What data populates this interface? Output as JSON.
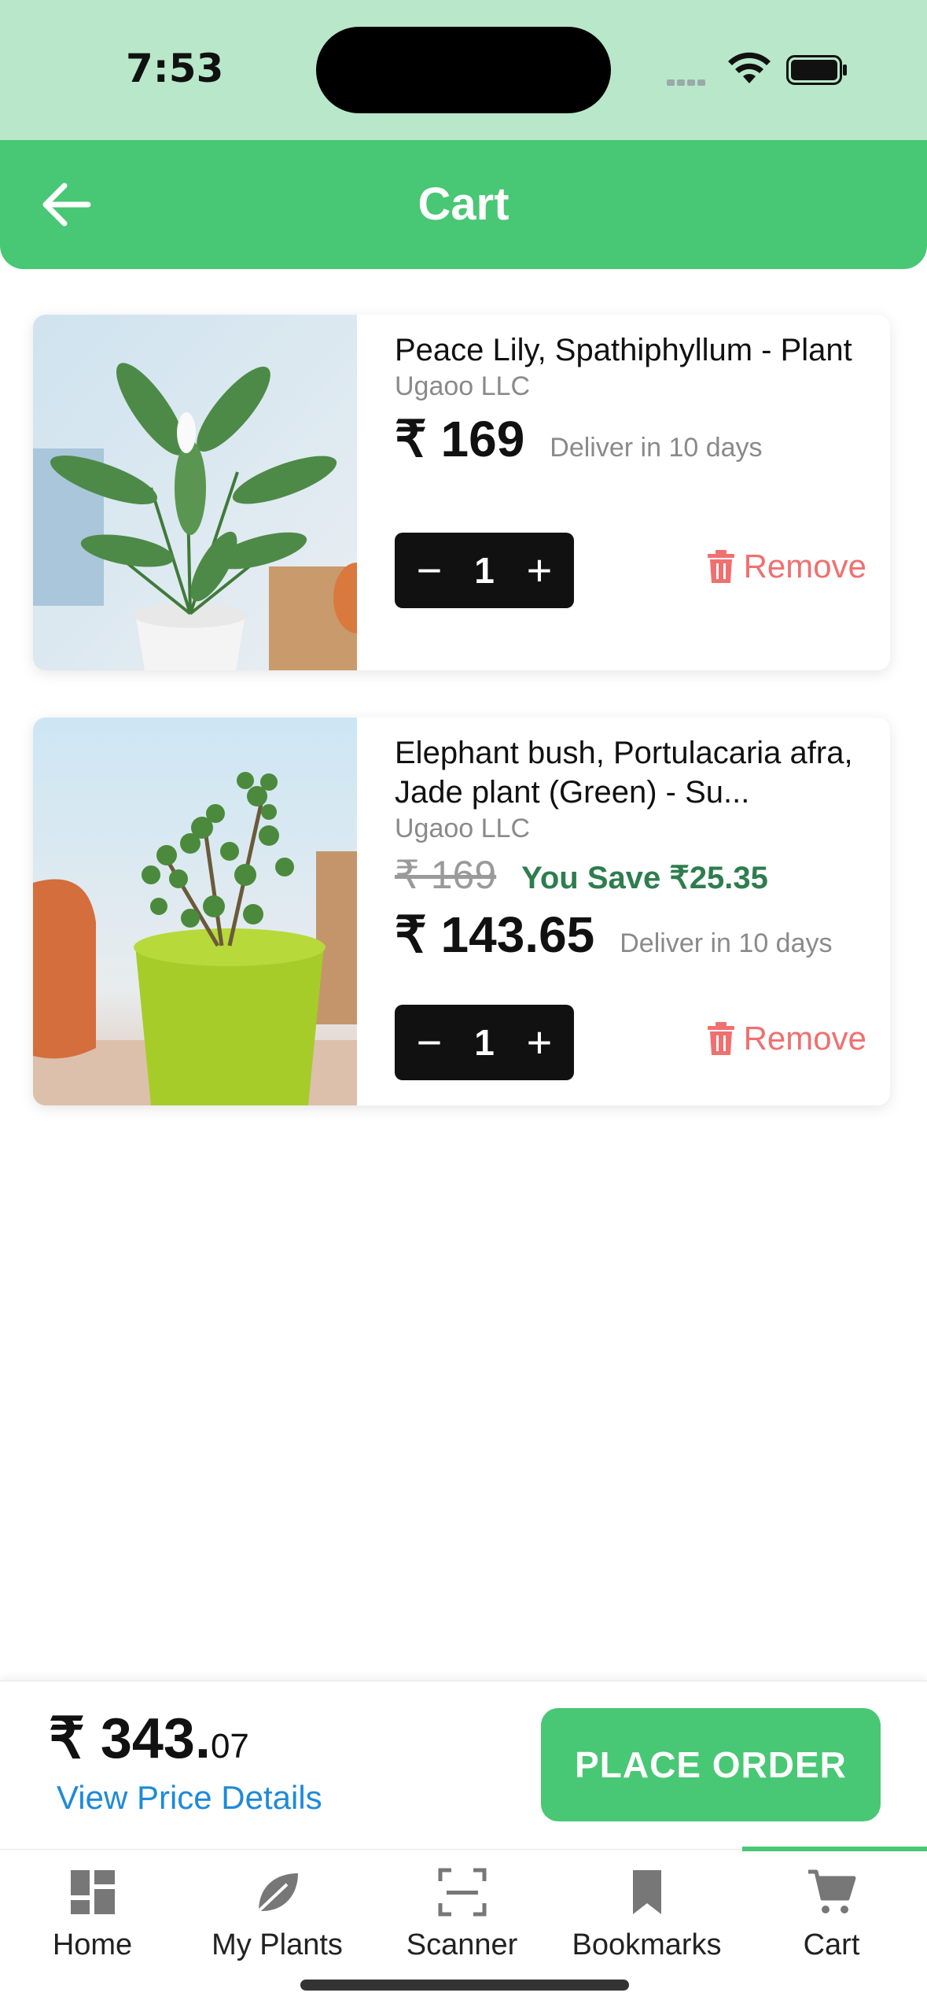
{
  "status_bar": {
    "time": "7:53"
  },
  "header": {
    "title": "Cart"
  },
  "cart_items": [
    {
      "name": "Peace Lily, Spathiphyllum - Plant",
      "seller": "Ugaoo LLC",
      "price": "₹ 169",
      "delivery": "Deliver in 10 days",
      "quantity": "1",
      "remove_label": "Remove"
    },
    {
      "name": "Elephant bush, Portulacaria afra, Jade plant (Green) - Su...",
      "seller": "Ugaoo LLC",
      "original_price": "₹ 169",
      "savings": "You Save ₹25.35",
      "price": "₹ 143.65",
      "delivery": "Deliver in 10 days",
      "quantity": "1",
      "remove_label": "Remove"
    }
  ],
  "checkout": {
    "total_main": "₹ 343.",
    "total_decimal": "07",
    "view_details": "View Price Details",
    "place_order": "PLACE ORDER"
  },
  "tabs": [
    {
      "label": "Home",
      "icon": "home-grid-icon"
    },
    {
      "label": "My Plants",
      "icon": "leaf-icon"
    },
    {
      "label": "Scanner",
      "icon": "scanner-icon"
    },
    {
      "label": "Bookmarks",
      "icon": "bookmark-icon"
    },
    {
      "label": "Cart",
      "icon": "cart-icon",
      "active": true
    }
  ],
  "colors": {
    "brand_green": "#48c774",
    "status_bar_green": "#b8e8c9",
    "remove_red": "#f07070",
    "save_green": "#2e7d4f",
    "link_blue": "#1f8ad8"
  }
}
